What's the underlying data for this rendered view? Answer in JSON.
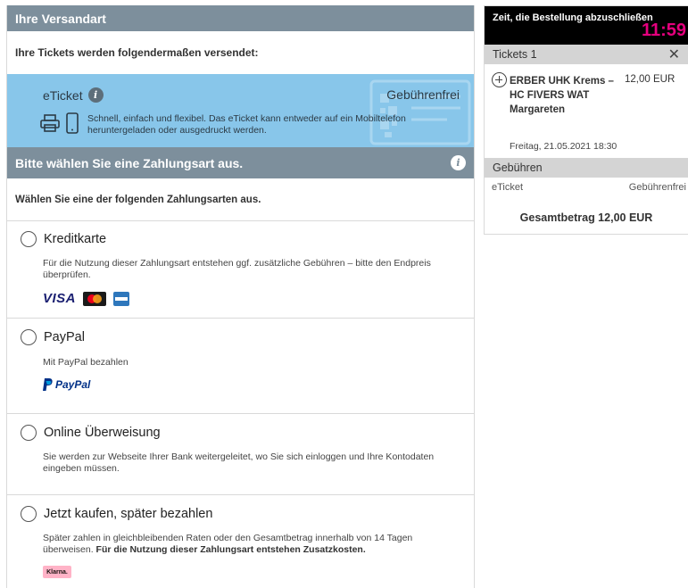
{
  "shipping": {
    "header": "Ihre Versandart",
    "subtitle": "Ihre Tickets werden folgendermaßen versendet:",
    "option": {
      "name": "eTicket",
      "fee": "Gebührenfrei",
      "description": "Schnell, einfach und flexibel. Das eTicket kann entweder auf ein Mobiltelefon heruntergeladen oder ausgedruckt werden.",
      "icons": [
        "printer-icon",
        "mobile-phone-icon",
        "info-icon"
      ]
    },
    "colors": {
      "header_bg": "#7d8f9c",
      "option_bg": "#88c6ea"
    }
  },
  "payment": {
    "header": "Bitte wählen Sie eine Zahlungsart aus.",
    "subtitle": "Wählen Sie eine der folgenden Zahlungsarten aus.",
    "methods": [
      {
        "name": "Kreditkarte",
        "description": "Für die Nutzung dieser Zahlungsart entstehen ggf. zusätzliche Gebühren – bitte den Endpreis überprüfen.",
        "logos": [
          "VISA",
          "mastercard",
          "amex"
        ]
      },
      {
        "name": "PayPal",
        "description": "Mit PayPal bezahlen",
        "logo": "PayPal"
      },
      {
        "name": "Online Überweisung",
        "description": "Sie werden zur Webseite Ihrer Bank weitergeleitet, wo Sie sich einloggen und Ihre Kontodaten eingeben müssen."
      },
      {
        "name": "Jetzt kaufen, später bezahlen",
        "description": "Später zahlen in gleichbleibenden Raten oder den Gesamtbetrag innerhalb von 14 Tagen überweisen.",
        "description_bold": "Für die Nutzung dieser Zahlungsart entstehen Zusatzkosten.",
        "logo": "Klarna."
      }
    ]
  },
  "summary": {
    "timer_label": "Zeit, die Bestellung abzuschließen",
    "timer_value": "11:59",
    "tickets_header": "Tickets 1",
    "ticket": {
      "event": "ERBER UHK Krems – HC FIVERS WAT Margareten",
      "price": "12,00 EUR",
      "date": "Freitag, 21.05.2021 18:30"
    },
    "fees_header": "Gebühren",
    "fee_name": "eTicket",
    "fee_value": "Gebührenfrei",
    "total": "Gesamtbetrag 12,00 EUR",
    "colors": {
      "timer_bg": "#000000",
      "timer_accent": "#e6007e",
      "section_bg": "#d4d4d4"
    }
  }
}
